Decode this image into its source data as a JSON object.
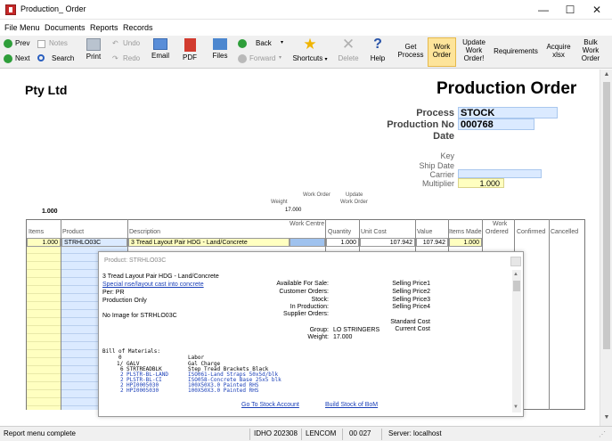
{
  "window": {
    "title": "Production_ Order",
    "min": "—",
    "max": "☐",
    "close": "✕"
  },
  "menu": [
    "File Menu",
    "Documents",
    "Reports",
    "Records"
  ],
  "toolbar": {
    "prev": "Prev",
    "next": "Next",
    "notes": "Notes",
    "search": "Search",
    "undo": "Undo",
    "redo": "Redo",
    "print": "Print",
    "email": "Email",
    "pdf": "PDF",
    "files": "Files",
    "back": "Back",
    "forward": "Forward",
    "shortcuts": "Shortcuts",
    "delete": "Delete",
    "help": "Help",
    "get_process": [
      "Get",
      "Process"
    ],
    "work_order": [
      "Work",
      "Order"
    ],
    "update_work_order": [
      "Update",
      "Work",
      "Order!"
    ],
    "requirements": "Requirements",
    "acquire_xlsx": [
      "Acquire",
      "xlsx"
    ],
    "bulk_work_order": [
      "Bulk",
      "Work",
      "Order"
    ]
  },
  "header": {
    "company": "Pty Ltd",
    "doc_title": "Production Order",
    "process_label": "Process",
    "process_value": "STOCK",
    "production_no_label": "Production No",
    "production_no_value": "000768",
    "date_label": "Date",
    "key_label": "Key",
    "ship_date_label": "Ship Date",
    "carrier_label": "Carrier",
    "multiplier_label": "Multiplier",
    "multiplier_value": "1.000",
    "weight_label": "Weight",
    "weight_value": "17.000",
    "work_order_label": "Work Order",
    "update_work_order_label": [
      "Update",
      "Work Order"
    ],
    "qty_total": "1.000"
  },
  "table": {
    "work_centre_label": "Work Centre",
    "work_label": "Work",
    "columns": [
      "Items",
      "Product",
      "Description",
      "Quantity",
      "Unit Cost",
      "Value",
      "Items Made",
      "Ordered",
      "Confirmed",
      "Cancelled"
    ],
    "row": {
      "items": "1.000",
      "product": "STRHLO03C",
      "description": "3 Tread Layout Pair HDG - Land/Concrete",
      "quantity": "1.000",
      "unit_cost": "107.942",
      "value": "107.942",
      "items_made": "1.000"
    }
  },
  "popup": {
    "header": "Product: STRHLO03C",
    "description": "3 Tread Layout Pair HDG - Land/Concrete",
    "special_link": "Special nse/layout cast into concrete",
    "per": "Per: PR",
    "production_only": "Production Only",
    "no_image": "No Image for STRHLO03C",
    "labels": [
      "Available For Sale:",
      "Customer Orders:",
      "Stock:",
      "In Production:",
      "Supplier Orders:"
    ],
    "selling": [
      "Selling Price1",
      "Selling Price2",
      "Selling Price3",
      "Selling Price4"
    ],
    "standard_cost": "Standard Cost",
    "current_cost": "Current Cost",
    "group_label": "Group:",
    "group_value": "LO STRINGERS",
    "weight_label": "Weight:",
    "weight_value": "17.000",
    "bom_title": "Bill of Materials:",
    "bom_black": [
      {
        "qty": "0",
        "code": "",
        "desc": "Labor"
      },
      {
        "qty": "1/",
        "code": "GALV",
        "desc": "Gal Charge"
      },
      {
        "qty": "6",
        "code": "STRTREADBLK",
        "desc": "Step Tread Brackets Black"
      }
    ],
    "bom_blue": [
      {
        "qty": "2",
        "code": "PLSTR-BL-LAND",
        "desc": "ISO061-Land Straps 50x5d/blk"
      },
      {
        "qty": "2",
        "code": "PLSTR-BL-CI",
        "desc": "ISO058-Concrete Base 25x5 blk"
      },
      {
        "qty": "2",
        "code": "HPI0005030",
        "desc": "100X50X3.0 Painted RHS"
      },
      {
        "qty": "2",
        "code": "HPI0005030",
        "desc": "100X50X3.0 Painted RHS"
      }
    ],
    "goto_stock": "Go To Stock Account",
    "build_stock": "Build Stock of BoM"
  },
  "status": {
    "message": "Report menu complete",
    "idho": "IDHO 202308",
    "lencom": "LENCOM",
    "code": "00 027",
    "server": "Server: localhost"
  }
}
